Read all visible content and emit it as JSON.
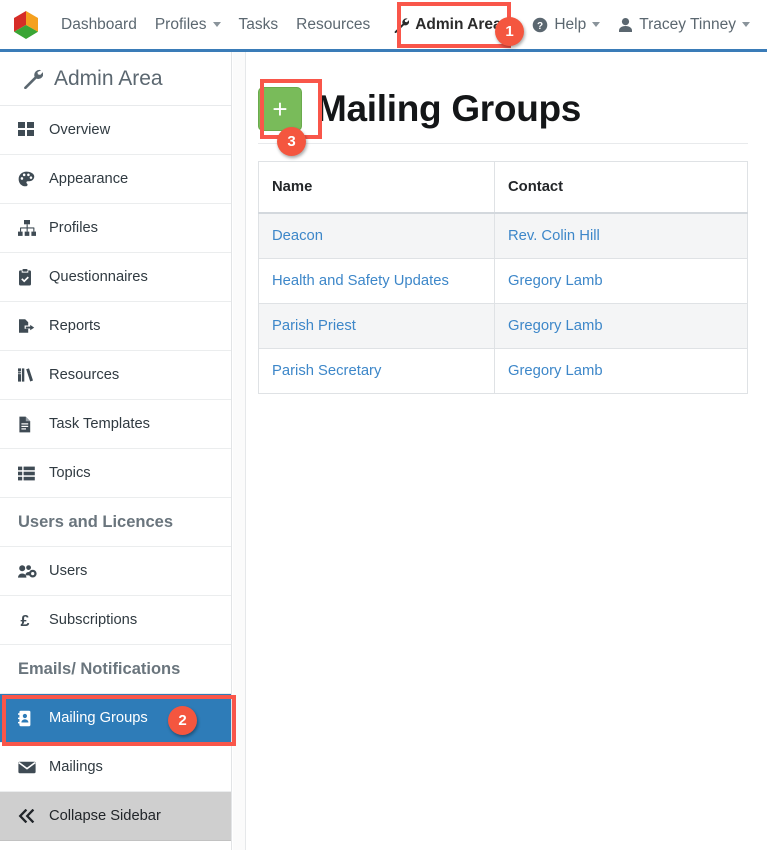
{
  "navbar": {
    "logo_icon": "cube-logo-icon",
    "logo_colors": {
      "red": "#d62d27",
      "orange": "#f5a01e",
      "green": "#3aa535"
    },
    "items": [
      {
        "label": "Dashboard",
        "icon": null,
        "caret": false
      },
      {
        "label": "Profiles",
        "icon": null,
        "caret": true
      },
      {
        "label": "Tasks",
        "icon": null,
        "caret": false
      },
      {
        "label": "Resources",
        "icon": null,
        "caret": false
      }
    ],
    "admin_area": {
      "label": "Admin Area",
      "icon": "wrench-icon"
    },
    "right_items": [
      {
        "label": "Help",
        "icon": "help-circle-icon",
        "caret": true
      },
      {
        "label": "Tracey Tinney",
        "icon": "user-icon",
        "caret": true
      }
    ],
    "accent_color": "#3a7cb8"
  },
  "sidebar": {
    "header": {
      "label": "Admin Area",
      "icon": "wrench-icon"
    },
    "items": [
      {
        "label": "Overview",
        "icon": "grid-icon",
        "type": "item",
        "active": false
      },
      {
        "label": "Appearance",
        "icon": "palette-icon",
        "type": "item",
        "active": false
      },
      {
        "label": "Profiles",
        "icon": "sitemap-icon",
        "type": "item",
        "active": false
      },
      {
        "label": "Questionnaires",
        "icon": "clipboard-check-icon",
        "type": "item",
        "active": false
      },
      {
        "label": "Reports",
        "icon": "file-export-icon",
        "type": "item",
        "active": false
      },
      {
        "label": "Resources",
        "icon": "books-icon",
        "type": "item",
        "active": false
      },
      {
        "label": "Task Templates",
        "icon": "file-lines-icon",
        "type": "item",
        "active": false
      },
      {
        "label": "Topics",
        "icon": "list-icon",
        "type": "item",
        "active": false
      },
      {
        "label": "Users and Licences",
        "icon": null,
        "type": "group",
        "active": false
      },
      {
        "label": "Users",
        "icon": "users-gear-icon",
        "type": "item",
        "active": false
      },
      {
        "label": "Subscriptions",
        "icon": "pound-sign-icon",
        "type": "item",
        "active": false
      },
      {
        "label": "Emails/ Notifications",
        "icon": null,
        "type": "group",
        "active": false
      },
      {
        "label": "Mailing Groups",
        "icon": "address-book-icon",
        "type": "item",
        "active": true
      },
      {
        "label": "Mailings",
        "icon": "envelope-icon",
        "type": "item",
        "active": false
      },
      {
        "label": "Collapse Sidebar",
        "icon": "chevrons-left-icon",
        "type": "collapse",
        "active": false
      }
    ],
    "active_color": "#2e7cb8"
  },
  "main": {
    "add_button_label": "+",
    "add_button_color": "#79bb5a",
    "title": "Mailing Groups",
    "table": {
      "columns": [
        "Name",
        "Contact"
      ],
      "rows": [
        {
          "name": "Deacon",
          "contact": "Rev. Colin Hill"
        },
        {
          "name": "Health and Safety Updates",
          "contact": "Gregory Lamb"
        },
        {
          "name": "Parish Priest",
          "contact": "Gregory Lamb"
        },
        {
          "name": "Parish Secretary",
          "contact": "Gregory Lamb"
        }
      ],
      "link_color": "#3d87c9"
    }
  },
  "annotations": {
    "color": "#f4563f",
    "badges": [
      {
        "number": "1",
        "target": "nav-admin-area"
      },
      {
        "number": "2",
        "target": "sidebar-item-mailing-groups"
      },
      {
        "number": "3",
        "target": "add-button"
      }
    ]
  }
}
